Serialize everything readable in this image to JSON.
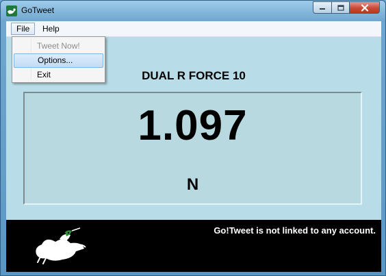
{
  "window": {
    "title": "GoTweet"
  },
  "menu": {
    "file_label": "File",
    "help_label": "Help",
    "file_items": [
      {
        "label": "Tweet Now!",
        "enabled": false
      },
      {
        "label": "Options...",
        "enabled": true,
        "highlighted": true
      },
      {
        "label": "Exit",
        "enabled": true
      }
    ]
  },
  "main": {
    "sensor_name": "DUAL R FORCE 10",
    "value": "1.097",
    "unit": "N"
  },
  "status": {
    "message": "Go!Tweet is not linked to any account."
  },
  "colors": {
    "content_background": "#b8dde8",
    "footer_background": "#000000"
  }
}
